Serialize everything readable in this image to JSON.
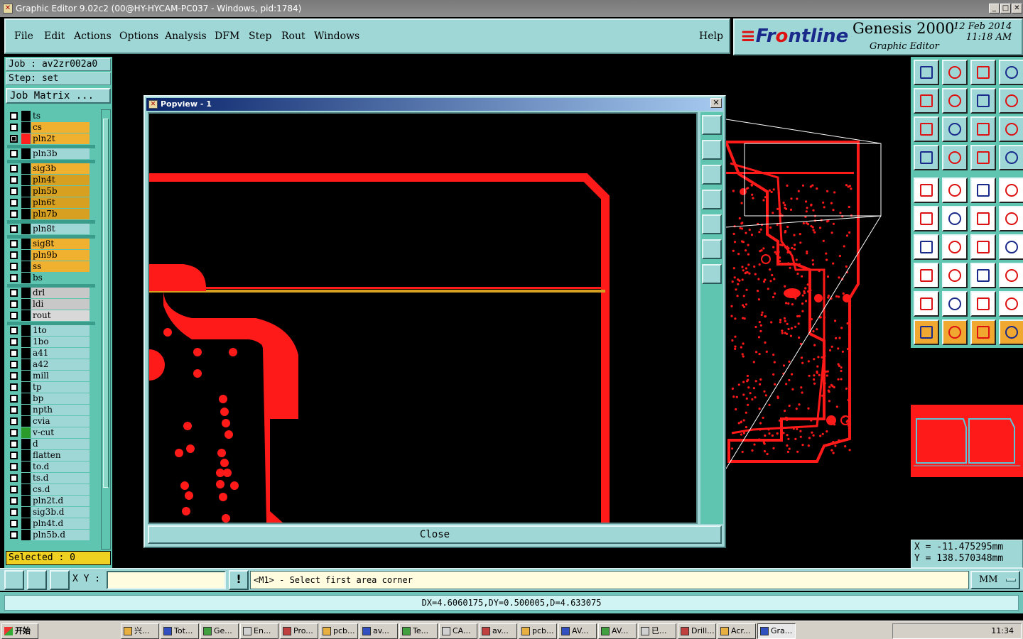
{
  "window": {
    "title": "Graphic Editor 9.02c2 (00@HY-HYCAM-PC037 - Windows, pid:1784)"
  },
  "menu": [
    "File",
    "Edit",
    "Actions",
    "Options",
    "Analysis",
    "DFM",
    "Step",
    "Rout",
    "Windows"
  ],
  "help_label": "Help",
  "brand": {
    "logo_prefix": "Fr",
    "logo_o": "o",
    "logo_suffix": "ntline",
    "product": "Genesis 2000",
    "subtitle": "Graphic Editor",
    "date": "12 Feb 2014",
    "time": "11:18 AM"
  },
  "job": {
    "job_label": "Job : av2zr002a0",
    "step_label": "Step: set",
    "matrix_button": "Job Matrix ..."
  },
  "layers": [
    {
      "name": "ts",
      "color": "#5fc4b0",
      "checked": false,
      "swatch": "#000"
    },
    {
      "name": "cs",
      "color": "#f0b030",
      "checked": false,
      "swatch": "#000"
    },
    {
      "name": "pln2t",
      "color": "#f0b030",
      "checked": true,
      "swatch": "#ff2020"
    },
    {
      "name": "pln3b",
      "color": "#9fd6d6",
      "checked": false,
      "swatch": "#000"
    },
    {
      "name": "sig3b",
      "color": "#f0b030",
      "checked": false,
      "swatch": "#000"
    },
    {
      "name": "pln4t",
      "color": "#d8a020",
      "checked": false,
      "swatch": "#000"
    },
    {
      "name": "pln5b",
      "color": "#d8a020",
      "checked": false,
      "swatch": "#000"
    },
    {
      "name": "pln6t",
      "color": "#d8a020",
      "checked": false,
      "swatch": "#000"
    },
    {
      "name": "pln7b",
      "color": "#d8a020",
      "checked": false,
      "swatch": "#000"
    },
    {
      "name": "pln8t",
      "color": "#9fd6d6",
      "checked": false,
      "swatch": "#000"
    },
    {
      "name": "sig8t",
      "color": "#f0b030",
      "checked": false,
      "swatch": "#000"
    },
    {
      "name": "pln9b",
      "color": "#f0b030",
      "checked": false,
      "swatch": "#000"
    },
    {
      "name": "ss",
      "color": "#f0b030",
      "checked": false,
      "swatch": "#000"
    },
    {
      "name": "bs",
      "color": "#5fc4b0",
      "checked": false,
      "swatch": "#000"
    },
    {
      "name": "drl",
      "color": "#c8c8c8",
      "checked": false,
      "swatch": "#000"
    },
    {
      "name": "ldi",
      "color": "#c8c8c8",
      "checked": false,
      "swatch": "#000"
    },
    {
      "name": "rout",
      "color": "#d8d8d8",
      "checked": false,
      "swatch": "#000"
    },
    {
      "name": "1to",
      "color": "#9fd6d6",
      "checked": false,
      "swatch": "#000"
    },
    {
      "name": "1bo",
      "color": "#9fd6d6",
      "checked": false,
      "swatch": "#000"
    },
    {
      "name": "a41",
      "color": "#9fd6d6",
      "checked": false,
      "swatch": "#000"
    },
    {
      "name": "a42",
      "color": "#9fd6d6",
      "checked": false,
      "swatch": "#000"
    },
    {
      "name": "mill",
      "color": "#9fd6d6",
      "checked": false,
      "swatch": "#000"
    },
    {
      "name": "tp",
      "color": "#9fd6d6",
      "checked": false,
      "swatch": "#000"
    },
    {
      "name": "bp",
      "color": "#9fd6d6",
      "checked": false,
      "swatch": "#000"
    },
    {
      "name": "npth",
      "color": "#9fd6d6",
      "checked": false,
      "swatch": "#000"
    },
    {
      "name": "cvia",
      "color": "#9fd6d6",
      "checked": false,
      "swatch": "#000"
    },
    {
      "name": "v-cut",
      "color": "#9fd6d6",
      "checked": false,
      "swatch": "#2a9a2a"
    },
    {
      "name": "d",
      "color": "#9fd6d6",
      "checked": false,
      "swatch": "#000"
    },
    {
      "name": "flatten",
      "color": "#9fd6d6",
      "checked": false,
      "swatch": "#000"
    },
    {
      "name": "to.d",
      "color": "#9fd6d6",
      "checked": false,
      "swatch": "#000"
    },
    {
      "name": "ts.d",
      "color": "#9fd6d6",
      "checked": false,
      "swatch": "#000"
    },
    {
      "name": "cs.d",
      "color": "#9fd6d6",
      "checked": false,
      "swatch": "#000"
    },
    {
      "name": "pln2t.d",
      "color": "#9fd6d6",
      "checked": false,
      "swatch": "#000"
    },
    {
      "name": "sig3b.d",
      "color": "#9fd6d6",
      "checked": false,
      "swatch": "#000"
    },
    {
      "name": "pln4t.d",
      "color": "#9fd6d6",
      "checked": false,
      "swatch": "#000"
    },
    {
      "name": "pln5b.d",
      "color": "#9fd6d6",
      "checked": false,
      "swatch": "#000"
    }
  ],
  "selected_label": "Selected : 0",
  "popview": {
    "title": "Popview - 1",
    "close_label": "Close"
  },
  "coords": {
    "x": "X = -11.475295mm",
    "y": "Y = 138.570348mm"
  },
  "cmd": {
    "xy_label": "X Y :",
    "xy_value": "",
    "prompt": "<M1> - Select first area corner",
    "units": "MM"
  },
  "status": {
    "measure": "DX=4.6060175,DY=0.500005,D=4.633075"
  },
  "taskbar": {
    "start": "开始",
    "tasks": [
      "兴...",
      "Tot...",
      "Ge...",
      "En...",
      "Pro...",
      "pcb...",
      "av...",
      "Te...",
      "CA...",
      "av...",
      "pcb...",
      "AV...",
      "AV...",
      "已...",
      "Drill...",
      "Acr...",
      "Gra..."
    ],
    "clock": "11:34"
  },
  "colors": {
    "accent_cyan": "#9fd6d6",
    "panel_teal": "#5fc4b0",
    "copper_red": "#ff1a1a",
    "highlight_yellow": "#f0b030"
  }
}
